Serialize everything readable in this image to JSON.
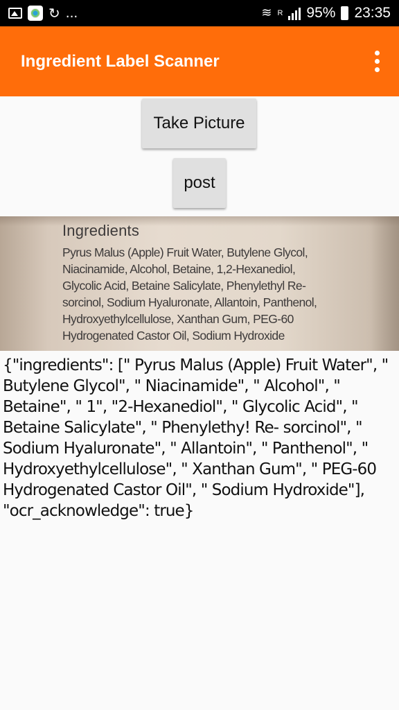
{
  "status_bar": {
    "left_icons": [
      "image-icon",
      "app-icon",
      "sync-icon"
    ],
    "ellipsis": "...",
    "battery": "95%",
    "time": "23:35",
    "signal_label": "R"
  },
  "app_bar": {
    "title": "Ingredient Label Scanner",
    "color": "#ff6d0a"
  },
  "buttons": {
    "take_picture": "Take Picture",
    "post": "post"
  },
  "photo": {
    "heading": "Ingredients",
    "lines": [
      "Pyrus Malus (Apple) Fruit Water, Butylene Glycol,",
      "Niacinamide, Alcohol, Betaine, 1,2-Hexanediol,",
      "Glycolic Acid, Betaine Salicylate, Phenylethyl Re-",
      "sorcinol, Sodium Hyaluronate, Allantoin, Panthenol,",
      "Hydroxyethylcellulose, Xanthan Gum, PEG-60",
      "Hydrogenated Castor Oil, Sodium Hydroxide"
    ]
  },
  "ocr_result": {
    "text": "{\"ingredients\": [\" Pyrus Malus (Apple) Fruit Water\", \" Butylene Glycol\", \" Niacinamide\", \" Alcohol\", \" Betaine\", \" 1\", \"2-Hexanediol\", \" Glycolic Acid\", \" Betaine Salicylate\", \" Phenylethy! Re- sorcinol\", \" Sodium Hyaluronate\", \" Allantoin\", \" Panthenol\", \" Hydroxyethylcellulose\", \" Xanthan Gum\", \" PEG-60 Hydrogenated Castor Oil\", \" Sodium Hydroxide\"], \"ocr_acknowledge\": true}"
  }
}
